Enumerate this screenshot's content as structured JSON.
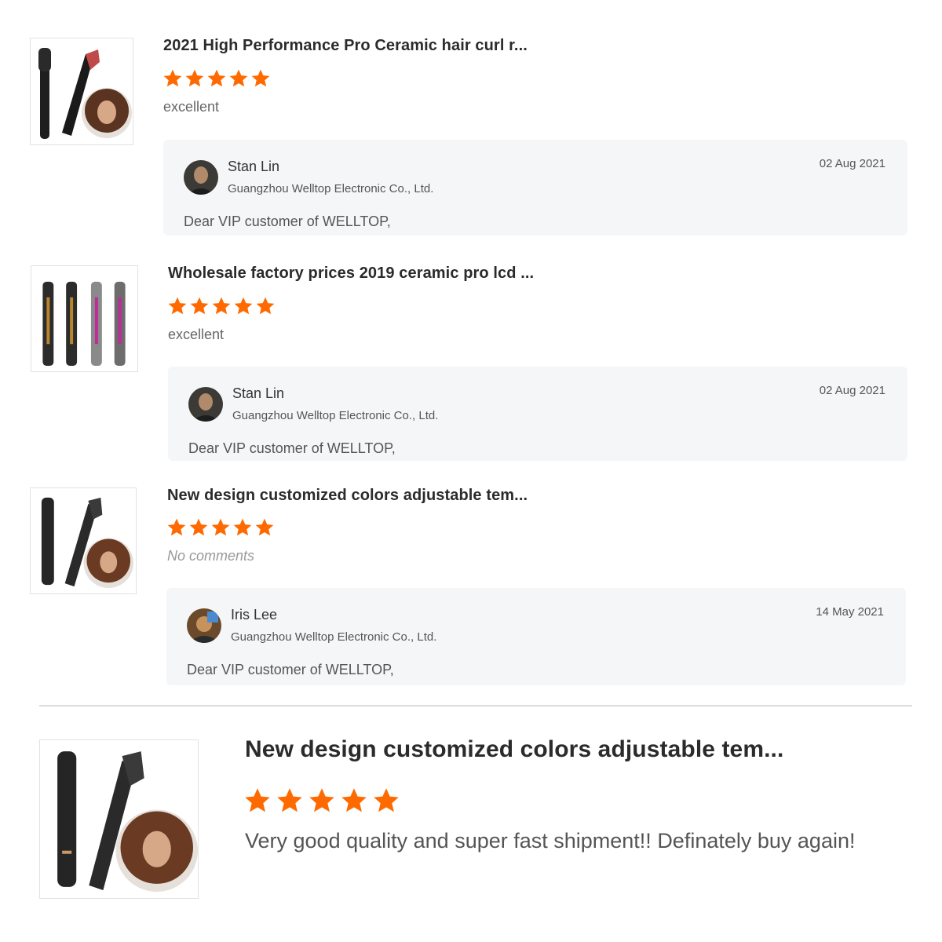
{
  "colors": {
    "star": "#ff6a00",
    "reply_bg": "#f5f6f8",
    "divider": "#dcdcdc"
  },
  "reviews": [
    {
      "title": "2021 High Performance Pro Ceramic hair curl r...",
      "rating": 5,
      "comment": "excellent",
      "reply": {
        "name": "Stan Lin",
        "company": "Guangzhou Welltop Electronic Co., Ltd.",
        "date": "02 Aug 2021",
        "text": "Dear VIP customer of WELLTOP,"
      }
    },
    {
      "title": "Wholesale factory prices 2019 ceramic pro lcd ...",
      "rating": 5,
      "comment": "excellent",
      "reply": {
        "name": "Stan Lin",
        "company": "Guangzhou Welltop Electronic Co., Ltd.",
        "date": "02 Aug 2021",
        "text": "Dear VIP customer of WELLTOP,"
      }
    },
    {
      "title": "New design customized colors adjustable tem...",
      "rating": 5,
      "comment": "No comments",
      "reply": {
        "name": "Iris Lee",
        "company": "Guangzhou Welltop Electronic Co., Ltd.",
        "date": "14 May 2021",
        "text": "Dear VIP customer of WELLTOP,"
      }
    }
  ],
  "featured": {
    "title": "New design customized colors adjustable tem...",
    "rating": 5,
    "comment": "Very good quality and super fast shipment!! Definately buy again!"
  }
}
